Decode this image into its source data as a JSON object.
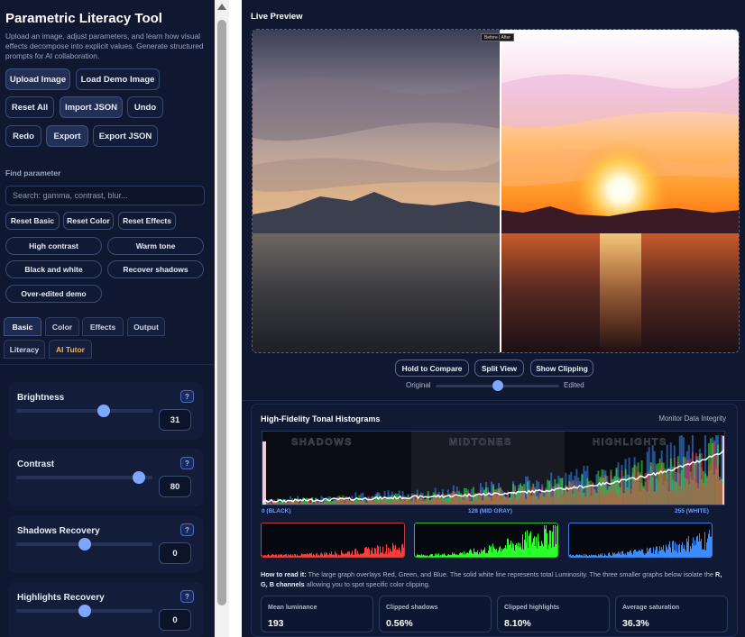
{
  "app": {
    "title": "Parametric Literacy Tool",
    "description": "Upload an image, adjust parameters, and learn how visual effects decompose into explicit values. Generate structured prompts for AI collaboration."
  },
  "actions": {
    "upload": "Upload Image",
    "load_demo": "Load Demo Image",
    "reset_all": "Reset All",
    "import_json": "Import JSON",
    "undo": "Undo",
    "redo": "Redo",
    "export": "Export",
    "export_json": "Export JSON"
  },
  "find": {
    "label": "Find parameter",
    "placeholder": "Search: gamma, contrast, blur..."
  },
  "resets": {
    "basic": "Reset Basic",
    "color": "Reset Color",
    "effects": "Reset Effects"
  },
  "presets": [
    "High contrast",
    "Warm tone",
    "Black and white",
    "Recover shadows",
    "Over-edited demo"
  ],
  "tabs": [
    "Basic",
    "Color",
    "Effects",
    "Output",
    "Literacy",
    "AI Tutor"
  ],
  "params": [
    {
      "label": "Brightness",
      "value": "31",
      "level": 0.64
    },
    {
      "label": "Contrast",
      "value": "80",
      "level": 0.9
    },
    {
      "label": "Shadows Recovery",
      "value": "0",
      "level": 0.5
    },
    {
      "label": "Highlights Recovery",
      "value": "0",
      "level": 0.5
    }
  ],
  "help_glyph": "?",
  "preview": {
    "title": "Live Preview",
    "compare_tag": "Before | After",
    "buttons": {
      "hold": "Hold to Compare",
      "split": "Split View",
      "clipping": "Show Clipping"
    },
    "slider": {
      "left": "Original",
      "right": "Edited",
      "level": 0.5
    }
  },
  "histogram": {
    "title": "High-Fidelity Tonal Histograms",
    "note": "Monitor Data Integrity",
    "zones": [
      "SHADOWS",
      "MIDTONES",
      "HIGHLIGHTS"
    ],
    "axis": {
      "black": "0 (BLACK)",
      "mid": "128 (MID GRAY)",
      "white": "255 (WHITE)"
    },
    "howto_lead": "How to read it:",
    "howto_text": "The large graph overlays Red, Green, and Blue. The solid white line represents total Luminosity. The three smaller graphs below isolate the",
    "howto_channels": "R, G, B channels",
    "howto_tail": "allowing you to spot specific color clipping.",
    "colors": {
      "red": "#ff3b3b",
      "green": "#2bff2b",
      "blue": "#3b8dff"
    }
  },
  "stats": [
    {
      "label": "Mean luminance",
      "value": "193"
    },
    {
      "label": "Clipped shadows",
      "value": "0.56%"
    },
    {
      "label": "Clipped highlights",
      "value": "8.10%"
    },
    {
      "label": "Average saturation",
      "value": "36.3%"
    }
  ]
}
